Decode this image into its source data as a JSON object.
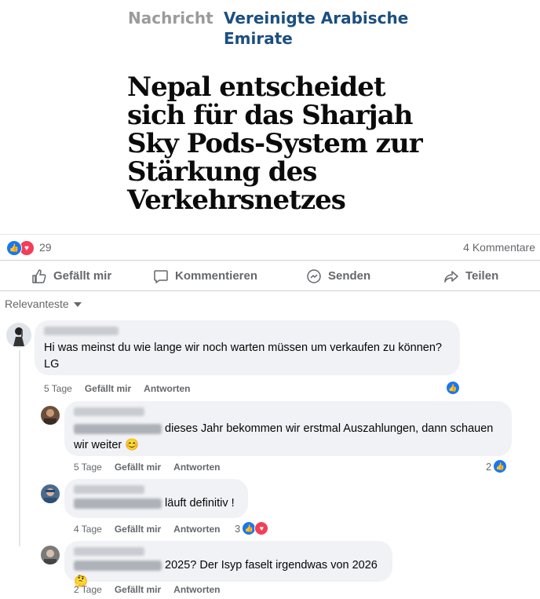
{
  "article": {
    "kicker_grey": "Nachricht",
    "kicker_blue": "Vereinigte Arabische Emirate",
    "headline": "Nepal entscheidet sich für das Sharjah Sky Pods-System zur Stärkung des Verkehrsnetzes"
  },
  "stats": {
    "reaction_count": "29",
    "comments": "4 Kommentare"
  },
  "actions": {
    "like": "Gefällt mir",
    "comment": "Kommentieren",
    "send": "Senden",
    "share": "Teilen"
  },
  "sort": {
    "label": "Relevanteste"
  },
  "comments": [
    {
      "text": "Hi was meinst du wie lange wir noch warten müssen um verkaufen zu können? LG",
      "time": "5 Tage",
      "like": "Gefällt mir",
      "reply": "Antworten",
      "reaction_count": ""
    },
    {
      "text": " dieses Jahr bekommen wir erstmal Auszahlungen, dann schauen wir weiter 😊",
      "time": "5 Tage",
      "like": "Gefällt mir",
      "reply": "Antworten",
      "reaction_count": "2"
    },
    {
      "text": " läuft definitiv !",
      "time": "4 Tage",
      "like": "Gefällt mir",
      "reply": "Antworten",
      "reaction_count": "3"
    },
    {
      "text": " 2025? Der Isyp faselt irgendwas von 2026 🤔",
      "time": "2 Tage",
      "like": "Gefällt mir",
      "reply": "Antworten",
      "reaction_count": ""
    }
  ],
  "colors": {
    "like_blue": "#1877f2",
    "love_red": "#f33e58",
    "kicker_blue": "#1b4f80",
    "bubble": "#f0f2f5"
  },
  "icons": [
    "like-icon",
    "love-icon",
    "comment-icon",
    "messenger-icon",
    "share-icon",
    "caret-down-icon"
  ]
}
